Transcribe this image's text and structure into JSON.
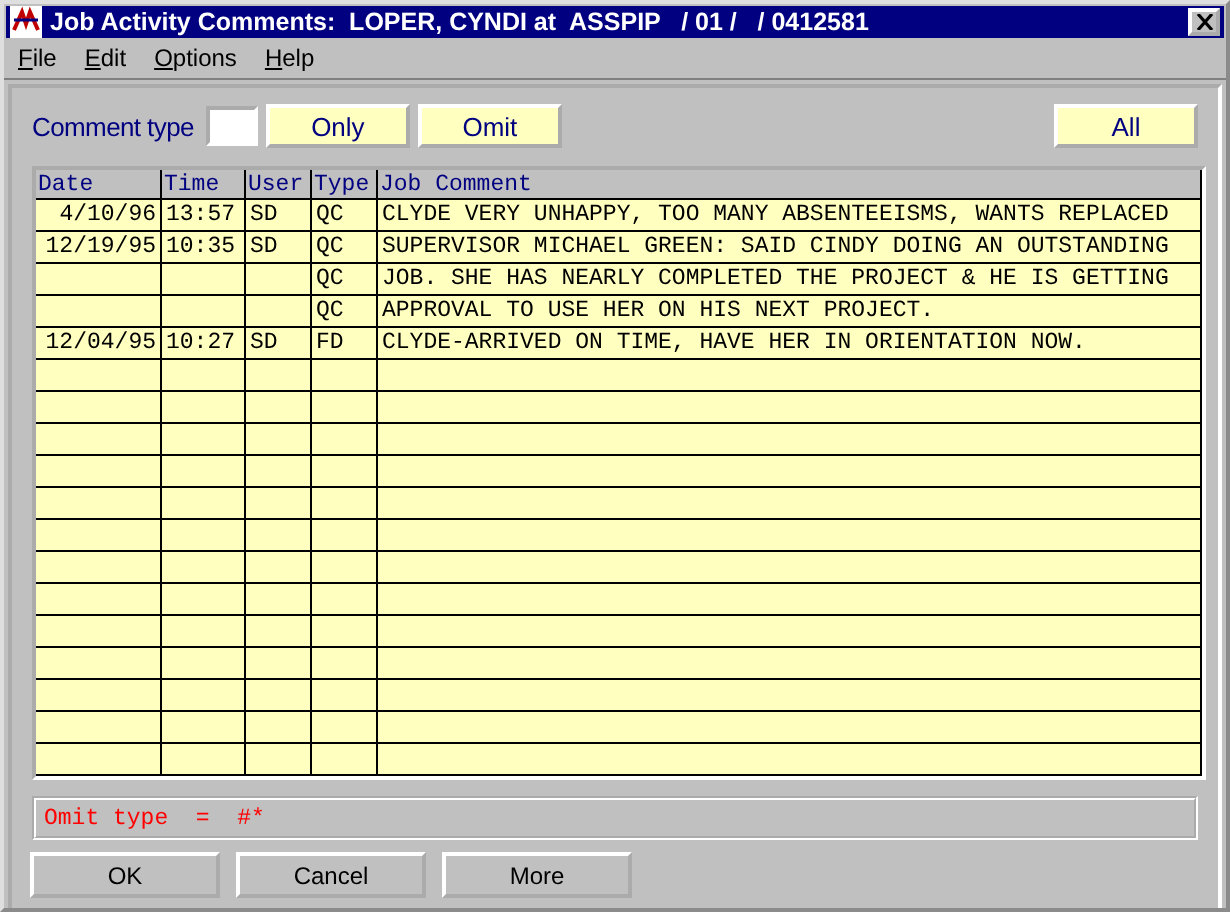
{
  "window": {
    "title": "Job Activity Comments:  LOPER, CYNDI at  ASSPIP   / 01 /   / 0412581"
  },
  "menu": [
    "File",
    "Edit",
    "Options",
    "Help"
  ],
  "filter": {
    "label": "Comment type",
    "buttons": [
      "Only",
      "Omit"
    ],
    "all_button": "All"
  },
  "table": {
    "columns": [
      "Date",
      "Time",
      "User",
      "Type",
      "Job Comment"
    ],
    "rows": [
      [
        "4/10/96",
        "13:57",
        "SD",
        "QC",
        "CLYDE VERY UNHAPPY, TOO MANY ABSENTEEISMS, WANTS REPLACED"
      ],
      [
        "12/19/95",
        "10:35",
        "SD",
        "QC",
        "SUPERVISOR MICHAEL GREEN: SAID CINDY DOING AN OUTSTANDING"
      ],
      [
        "",
        "",
        "",
        "QC",
        "JOB. SHE HAS NEARLY COMPLETED THE PROJECT & HE IS GETTING"
      ],
      [
        "",
        "",
        "",
        "QC",
        "APPROVAL TO USE HER ON HIS NEXT PROJECT."
      ],
      [
        "12/04/95",
        "10:27",
        "SD",
        "FD",
        "CLYDE-ARRIVED ON TIME, HAVE HER IN ORIENTATION NOW."
      ]
    ]
  },
  "status": "Omit type  =  #*",
  "buttons": [
    "OK",
    "Cancel",
    "More"
  ]
}
